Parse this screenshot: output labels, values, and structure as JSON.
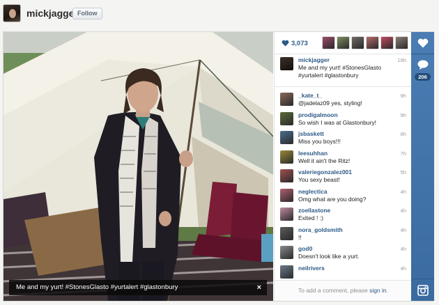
{
  "header": {
    "username": "mickjagger",
    "follow_label": "Follow"
  },
  "post": {
    "caption_overlay": "Me and my yurt! #StonesGlasto #yurtalert #glastonbury",
    "close_glyph": "×",
    "likes_count": "3,073",
    "comments_count": "206"
  },
  "likers": [
    {
      "color": "#9d4b6b"
    },
    {
      "color": "#7d8e5e"
    },
    {
      "color": "#6f6b66"
    },
    {
      "color": "#b76a6a"
    },
    {
      "color": "#c04a60"
    },
    {
      "color": "#8a7f76"
    }
  ],
  "owner_comment": {
    "user": "mickjagger",
    "text": "Me and my yurt! #StonesGlasto #yurtalert #glastonbury",
    "time": "18h",
    "color": "#3b3028"
  },
  "comments": [
    {
      "user": "_kate_t_",
      "text": "@jadelaz09 yes, styling!",
      "time": "9h",
      "color": "#8b6a5a"
    },
    {
      "user": "prodigalmoon",
      "text": "So wish I was at Glastonbury!",
      "time": "9h",
      "color": "#5a6b3a"
    },
    {
      "user": "jsbaskett",
      "text": "Miss you boys!!!",
      "time": "8h",
      "color": "#4a6f8f"
    },
    {
      "user": "leesuhhan",
      "text": "Well it ain't the Ritz!",
      "time": "7h",
      "color": "#9a8a3a"
    },
    {
      "user": "valeriegonzalez001",
      "text": "You sexy beast!",
      "time": "5h",
      "color": "#a05050"
    },
    {
      "user": "neglectica",
      "text": "Omg what are you doing?",
      "time": "4h",
      "color": "#b06070"
    },
    {
      "user": "zoellastone",
      "text": "Exited ! :)",
      "time": "4h",
      "color": "#c08aa0"
    },
    {
      "user": "nora_goldsmith",
      "text": "!!",
      "time": "4h",
      "color": "#5a5a5a"
    },
    {
      "user": "god0",
      "text": "Doesn't look like a yurt.",
      "time": "4h",
      "color": "#8a8a8a"
    },
    {
      "user": "neilrivers",
      "text": "",
      "time": "4h",
      "color": "#6a7a8a"
    }
  ],
  "comment_box": {
    "prefix": "To add a comment, please",
    "link": "sign in",
    "suffix": "."
  },
  "icons": {
    "like": "heart-icon",
    "comment": "speech-bubble-icon",
    "brand": "instagram-camera-icon"
  },
  "colors": {
    "link": "#2d5a86",
    "action_bar": "#3f72a8"
  }
}
